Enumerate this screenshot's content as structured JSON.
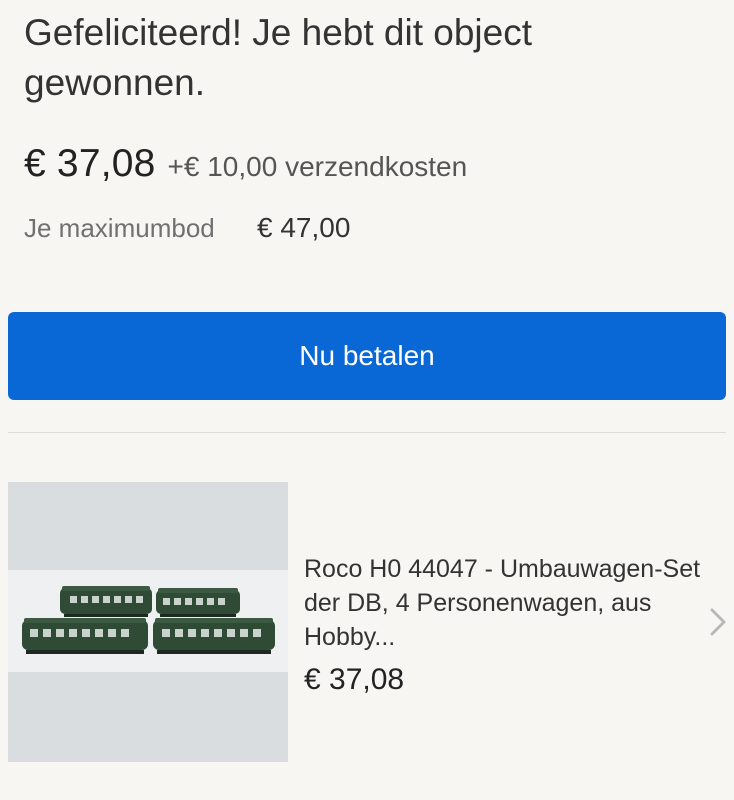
{
  "headline": "Gefeliciteerd! Je hebt dit object gewonnen.",
  "price": {
    "amount": "€ 37,08",
    "shipping": "+€ 10,00 verzendkosten"
  },
  "max_bid": {
    "label": "Je maximumbod",
    "value": "€ 47,00"
  },
  "pay_button": {
    "label": "Nu betalen",
    "color": "#0a68d6"
  },
  "item": {
    "image_icon": "train-cars-photo",
    "title": "Roco H0 44047 - Umbauwagen-Set der DB, 4 Personenwagen, aus Hobby...",
    "price": "€ 37,08",
    "chevron_icon": "chevron-right-icon"
  },
  "colors": {
    "background": "#f7f6f3",
    "train_green": "#2f4a35"
  }
}
